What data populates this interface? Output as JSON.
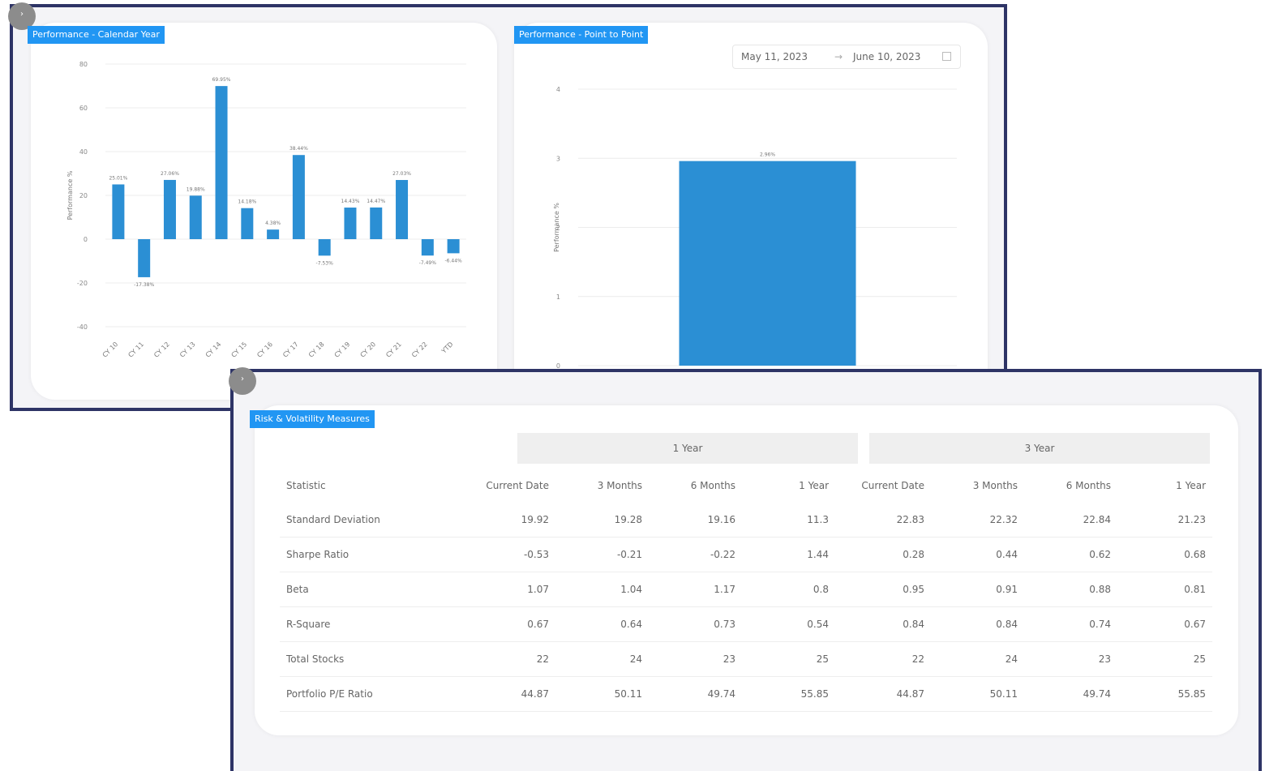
{
  "top_panel": {
    "calendar_card": {
      "tag": "Performance - Calendar Year"
    },
    "point_card": {
      "tag": "Performance - Point to Point",
      "date_from": "May 11, 2023",
      "date_sep": "→",
      "date_to": "June 10, 2023"
    }
  },
  "bottom_panel": {
    "tag": "Risk & Volatility Measures",
    "groups": [
      "1 Year",
      "3 Year"
    ],
    "columns": [
      "Statistic",
      "Current Date",
      "3 Months",
      "6 Months",
      "1 Year",
      "Current Date",
      "3 Months",
      "6 Months",
      "1 Year"
    ],
    "rows": [
      [
        "Standard Deviation",
        "19.92",
        "19.28",
        "19.16",
        "11.3",
        "22.83",
        "22.32",
        "22.84",
        "21.23"
      ],
      [
        "Sharpe Ratio",
        "-0.53",
        "-0.21",
        "-0.22",
        "1.44",
        "0.28",
        "0.44",
        "0.62",
        "0.68"
      ],
      [
        "Beta",
        "1.07",
        "1.04",
        "1.17",
        "0.8",
        "0.95",
        "0.91",
        "0.88",
        "0.81"
      ],
      [
        "R-Square",
        "0.67",
        "0.64",
        "0.73",
        "0.54",
        "0.84",
        "0.84",
        "0.74",
        "0.67"
      ],
      [
        "Total Stocks",
        "22",
        "24",
        "23",
        "25",
        "22",
        "24",
        "23",
        "25"
      ],
      [
        "Portfolio P/E Ratio",
        "44.87",
        "50.11",
        "49.74",
        "55.85",
        "44.87",
        "50.11",
        "49.74",
        "55.85"
      ]
    ]
  },
  "chart_data": [
    {
      "type": "bar",
      "ylabel": "Performance %",
      "ylim": [
        -40,
        80
      ],
      "yticks": [
        80,
        60,
        40,
        20,
        0,
        -20,
        -40
      ],
      "categories": [
        "CY 10",
        "CY 11",
        "CY 12",
        "CY 13",
        "CY 14",
        "CY 15",
        "CY 16",
        "CY 17",
        "CY 18",
        "CY 19",
        "CY 20",
        "CY 21",
        "CY 22",
        "YTD"
      ],
      "values": [
        25.01,
        -17.38,
        27.06,
        19.88,
        69.95,
        14.18,
        4.38,
        38.44,
        -7.53,
        14.43,
        14.47,
        27.03,
        -7.49,
        -6.44
      ],
      "value_labels": [
        "25.01%",
        "-17.38%",
        "27.06%",
        "19.88%",
        "69.95%",
        "14.18%",
        "4.38%",
        "38.44%",
        "-7.53%",
        "14.43%",
        "14.47%",
        "27.03%",
        "-7.49%",
        "-6.44%"
      ],
      "bar_color": "#2b8fd4",
      "grid": true
    },
    {
      "type": "bar",
      "ylabel": "Performance %",
      "ylim": [
        0,
        4
      ],
      "yticks": [
        4,
        3,
        2,
        1,
        0
      ],
      "categories": [
        ""
      ],
      "values": [
        2.96
      ],
      "value_labels": [
        "2.96%"
      ],
      "bar_color": "#2b8fd4",
      "grid": true
    }
  ]
}
